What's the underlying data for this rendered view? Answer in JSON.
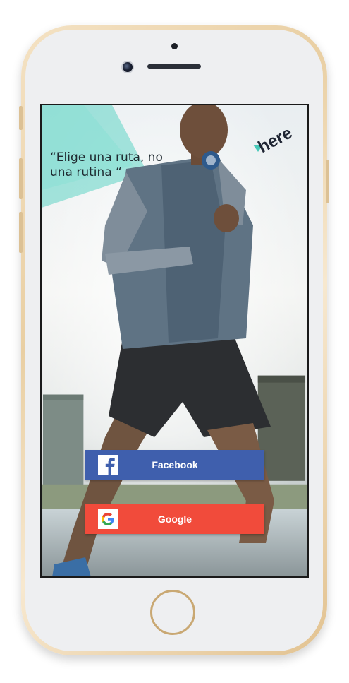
{
  "device": {
    "model": "iPhone"
  },
  "screen": {
    "quote": "“Elige una ruta, no una rutina “",
    "logo": {
      "text": "here",
      "icon": "here-logo"
    }
  },
  "buttons": {
    "facebook": {
      "label": "Facebook",
      "icon": "facebook-icon",
      "color": "#3f5fad"
    },
    "google": {
      "label": "Google",
      "icon": "google-icon",
      "color": "#f14b3b"
    }
  }
}
